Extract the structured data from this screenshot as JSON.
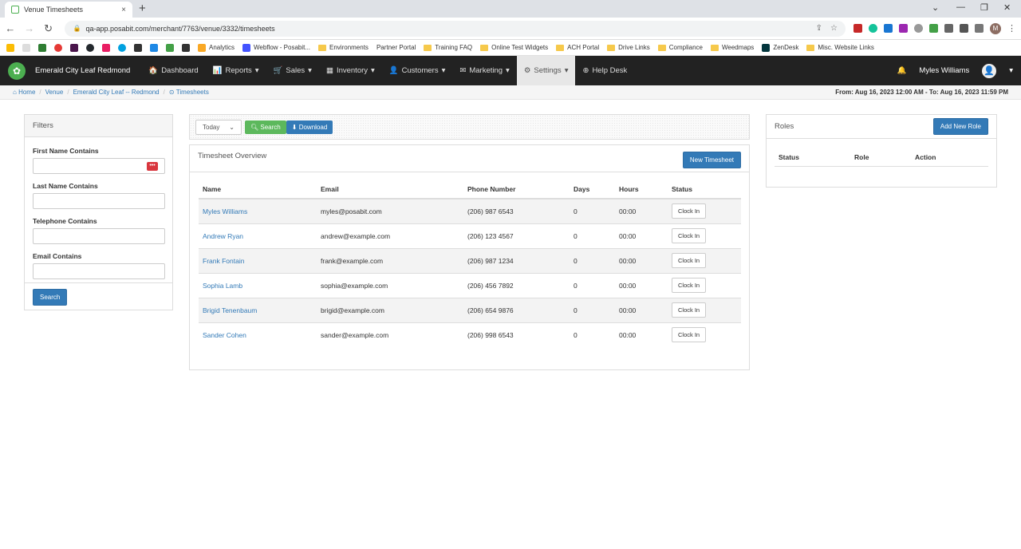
{
  "browser": {
    "tab_title": "Venue Timesheets",
    "tab_close": "×",
    "new_tab": "+",
    "url": "qa-app.posabit.com/merchant/7763/venue/3332/timesheets",
    "profile_initial": "M",
    "window_controls": [
      "⌄",
      "—",
      "❐",
      "✕"
    ],
    "bookmarks": [
      {
        "label": "Analytics",
        "icon": "analytics-icon"
      },
      {
        "label": "Webflow - Posabit...",
        "icon": "webflow-icon"
      },
      {
        "label": "Environments",
        "icon": "folder-icon"
      },
      {
        "label": "Partner Portal",
        "icon": "folder-icon"
      },
      {
        "label": "Training FAQ",
        "icon": "folder-icon"
      },
      {
        "label": "Online Test Widgets",
        "icon": "folder-icon"
      },
      {
        "label": "ACH Portal",
        "icon": "folder-icon"
      },
      {
        "label": "Drive Links",
        "icon": "folder-icon"
      },
      {
        "label": "Compliance",
        "icon": "folder-icon"
      },
      {
        "label": "Weedmaps",
        "icon": "folder-icon"
      },
      {
        "label": "ZenDesk",
        "icon": "zendesk-icon"
      },
      {
        "label": "Misc. Website Links",
        "icon": "folder-icon"
      }
    ]
  },
  "nav": {
    "brand": "Emerald City Leaf Redmond",
    "items": [
      {
        "label": "Dashboard",
        "icon": "🏠"
      },
      {
        "label": "Reports",
        "icon": "📊"
      },
      {
        "label": "Sales",
        "icon": "🛒"
      },
      {
        "label": "Inventory",
        "icon": "▦"
      },
      {
        "label": "Customers",
        "icon": "👤"
      },
      {
        "label": "Marketing",
        "icon": "✉"
      },
      {
        "label": "Settings",
        "icon": "⚙"
      },
      {
        "label": "Help Desk",
        "icon": "⊕"
      }
    ],
    "user": "Myles Williams"
  },
  "breadcrumb": {
    "home": "Home",
    "venue": "Venue",
    "venue_name": "Emerald City Leaf -- Redmond",
    "current": "Timesheets",
    "daterange": "From: Aug 16, 2023 12:00 AM - To: Aug 16, 2023 11:59 PM"
  },
  "filters": {
    "title": "Filters",
    "first_name_label": "First Name Contains",
    "last_name_label": "Last Name Contains",
    "telephone_label": "Telephone Contains",
    "email_label": "Email Contains",
    "search_button": "Search"
  },
  "toolbar": {
    "range_value": "Today",
    "search_button": "Search",
    "download_button": "Download"
  },
  "overview": {
    "title": "Timesheet Overview",
    "new_button": "New Timesheet",
    "columns": [
      "Name",
      "Email",
      "Phone Number",
      "Days",
      "Hours",
      "Status"
    ],
    "rows": [
      {
        "name": "Myles Williams",
        "email": "myles@posabit.com",
        "phone": "(206) 987 6543",
        "days": "0",
        "hours": "00:00",
        "action": "Clock In"
      },
      {
        "name": "Andrew Ryan",
        "email": "andrew@example.com",
        "phone": "(206) 123 4567",
        "days": "0",
        "hours": "00:00",
        "action": "Clock In"
      },
      {
        "name": "Frank Fontain",
        "email": "frank@example.com",
        "phone": "(206) 987 1234",
        "days": "0",
        "hours": "00:00",
        "action": "Clock In"
      },
      {
        "name": "Sophia Lamb",
        "email": "sophia@example.com",
        "phone": "(206) 456 7892",
        "days": "0",
        "hours": "00:00",
        "action": "Clock In"
      },
      {
        "name": "Brigid Tenenbaum",
        "email": "brigid@example.com",
        "phone": "(206) 654 9876",
        "days": "0",
        "hours": "00:00",
        "action": "Clock In"
      },
      {
        "name": "Sander Cohen",
        "email": "sander@example.com",
        "phone": "(206) 998 6543",
        "days": "0",
        "hours": "00:00",
        "action": "Clock In"
      }
    ]
  },
  "roles": {
    "title": "Roles",
    "add_button": "Add New Role",
    "columns": [
      "Status",
      "Role",
      "Action"
    ]
  }
}
